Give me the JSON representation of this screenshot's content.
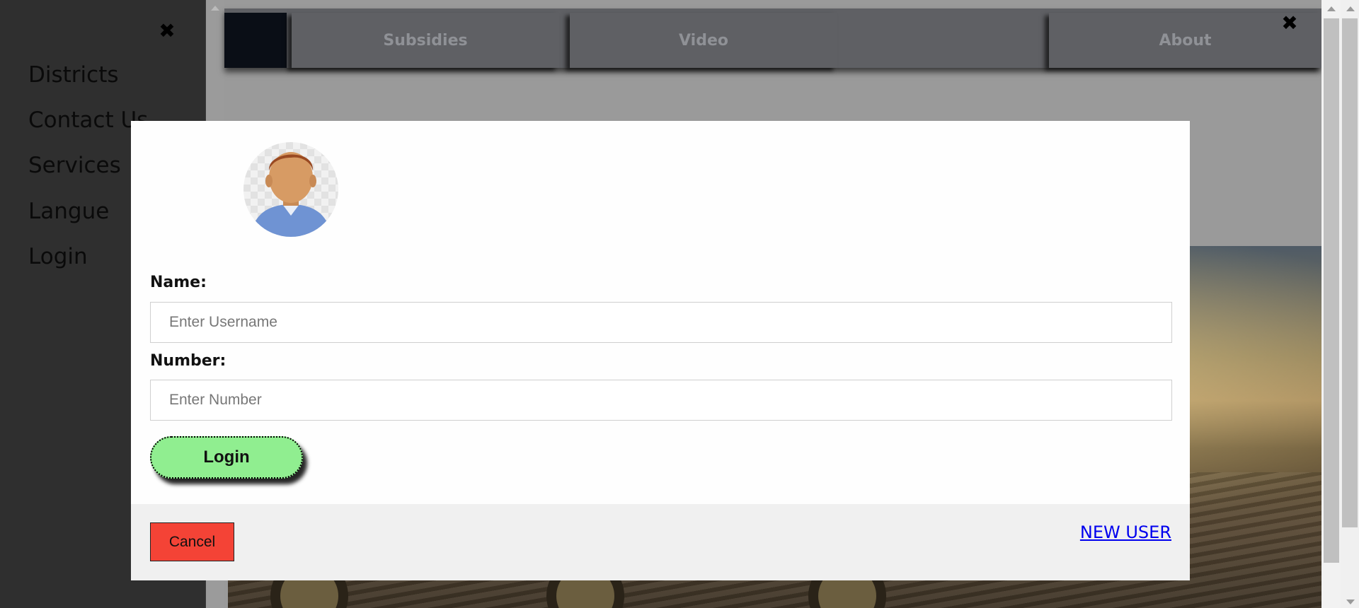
{
  "sidebar": {
    "close_icon": "close-icon",
    "items": [
      {
        "label": "Districts"
      },
      {
        "label": "Contact Us"
      },
      {
        "label": "Services"
      },
      {
        "label": "Langue"
      },
      {
        "label": "Login"
      }
    ]
  },
  "navbar": {
    "items": [
      {
        "label": "Subsidies"
      },
      {
        "label": "Video"
      },
      {
        "label": ""
      },
      {
        "label": "About"
      }
    ],
    "close_icon": "close-icon"
  },
  "modal": {
    "avatar_icon": "user-avatar-icon",
    "name_label": "Name:",
    "name_placeholder": "Enter Username",
    "name_value": "",
    "number_label": "Number:",
    "number_placeholder": "Enter Number",
    "number_value": "",
    "login_label": "Login",
    "cancel_label": "Cancel",
    "new_user_label": "NEW USER"
  },
  "colors": {
    "login_button": "#90ee90",
    "cancel_button": "#f44336",
    "link": "#0000ee",
    "sidebar_bg": "#2f2f2f",
    "navbar_bg": "#5f6064"
  }
}
